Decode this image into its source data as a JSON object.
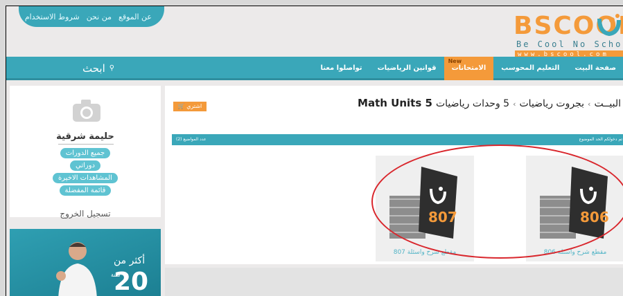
{
  "top_links": [
    "عن الموقع",
    "من نحن",
    "شروط الاستخدام"
  ],
  "logo": {
    "main": "BSCOOL",
    "tagline": "Be Cool No School",
    "url": "www.bscool.com"
  },
  "nav": {
    "items": [
      "صفحة البيت",
      "التعليم المحوسب",
      "الامتحانات",
      "قوانين الرياضيات",
      "تواصلوا معنا"
    ],
    "active_index": 2,
    "new_badge": "New"
  },
  "search": {
    "label": "ابحث"
  },
  "sidebar": {
    "username": "حليمة شرقية",
    "menu": [
      "جميع الدورات",
      "دوراتي",
      "المشاهدات الاخيرة",
      "قائمة المفضلة"
    ],
    "logout": "تسجيل الخروج"
  },
  "promo": {
    "text": "أكثر من",
    "number": "20",
    "small": "سنة"
  },
  "page": {
    "breadcrumb_home": "البيــت",
    "breadcrumb_section": "بجروت رياضيات",
    "breadcrumb_current": "5 وحدات رياضيات",
    "title_en": "5 Math Units",
    "buy_label": "اشتري",
    "bar_right": "تم دخولكم الحد الموضوع",
    "bar_left": "عدد المواضيع (2)"
  },
  "cards": [
    {
      "code": "806",
      "label": "مقطع شرح واسئلة 806"
    },
    {
      "code": "807",
      "label": "مقطع شرح واسئلة 807"
    }
  ],
  "colors": {
    "teal": "#3aa7b9",
    "orange": "#f49a3a",
    "highlight": "#d9262c"
  }
}
